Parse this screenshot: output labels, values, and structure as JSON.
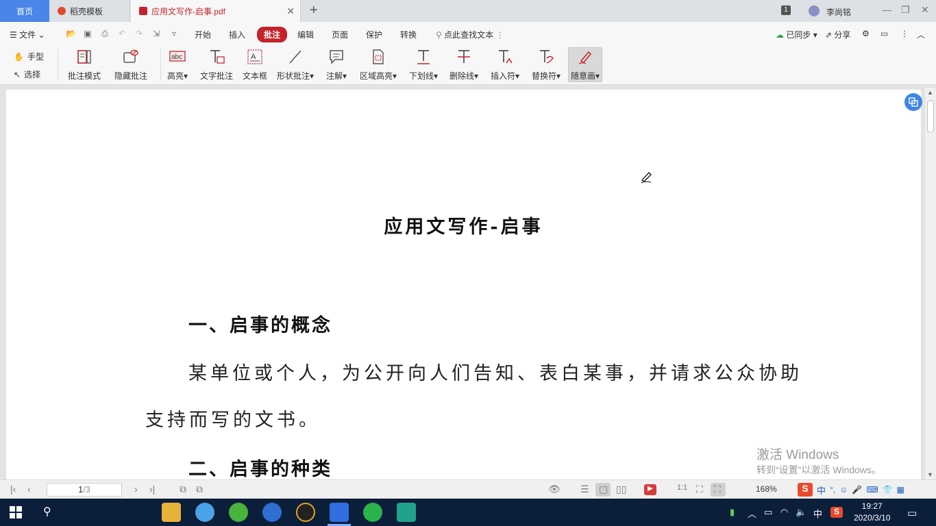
{
  "tabs": {
    "home": "首页",
    "template": "稻壳模板",
    "document": "应用文写作-启事.pdf"
  },
  "window": {
    "count_badge": "1",
    "user_name": "李尚铭"
  },
  "menu": {
    "file": "文件",
    "items": [
      "开始",
      "插入",
      "批注",
      "编辑",
      "页面",
      "保护",
      "转换"
    ],
    "active": "批注",
    "search": "点此查找文本",
    "sync": "已同步",
    "share": "分享"
  },
  "ribbon": {
    "hand": "手型",
    "select": "选择",
    "tools": [
      {
        "label": "批注模式",
        "icon": "comment-mode-icon"
      },
      {
        "label": "隐藏批注",
        "icon": "hide-comment-icon"
      },
      {
        "label": "高亮",
        "icon": "highlight-icon"
      },
      {
        "label": "文字批注",
        "icon": "text-comment-icon"
      },
      {
        "label": "文本框",
        "icon": "textbox-icon"
      },
      {
        "label": "形状批注",
        "icon": "shape-comment-icon"
      },
      {
        "label": "注解",
        "icon": "note-icon"
      },
      {
        "label": "区域高亮",
        "icon": "area-highlight-icon"
      },
      {
        "label": "下划线",
        "icon": "underline-icon"
      },
      {
        "label": "删除线",
        "icon": "strikethrough-icon"
      },
      {
        "label": "插入符",
        "icon": "insert-mark-icon"
      },
      {
        "label": "替换符",
        "icon": "replace-mark-icon"
      },
      {
        "label": "随意画",
        "icon": "freehand-draw-icon"
      }
    ],
    "selected": "随意画"
  },
  "document": {
    "title": "应用文写作-启事",
    "heading1": "一、启事的概念",
    "para1_line1": "某单位或个人，为公开向人们告知、表白某事，并请求公众协助",
    "para1_line2": "支持而写的文书。",
    "heading2": "二、启事的种类"
  },
  "watermark": {
    "line1": "激活 Windows",
    "line2": "转到“设置”以激活 Windows。"
  },
  "status": {
    "current_page": "1",
    "total_pages": "/3",
    "zoom": "168%"
  },
  "taskbar": {
    "time": "19:27",
    "date": "2020/3/10",
    "ime": "中"
  },
  "colors": {
    "accent_red": "#c4232b",
    "home_tab_blue": "#4a86e8",
    "taskbar_bg": "#0b1e3a"
  }
}
